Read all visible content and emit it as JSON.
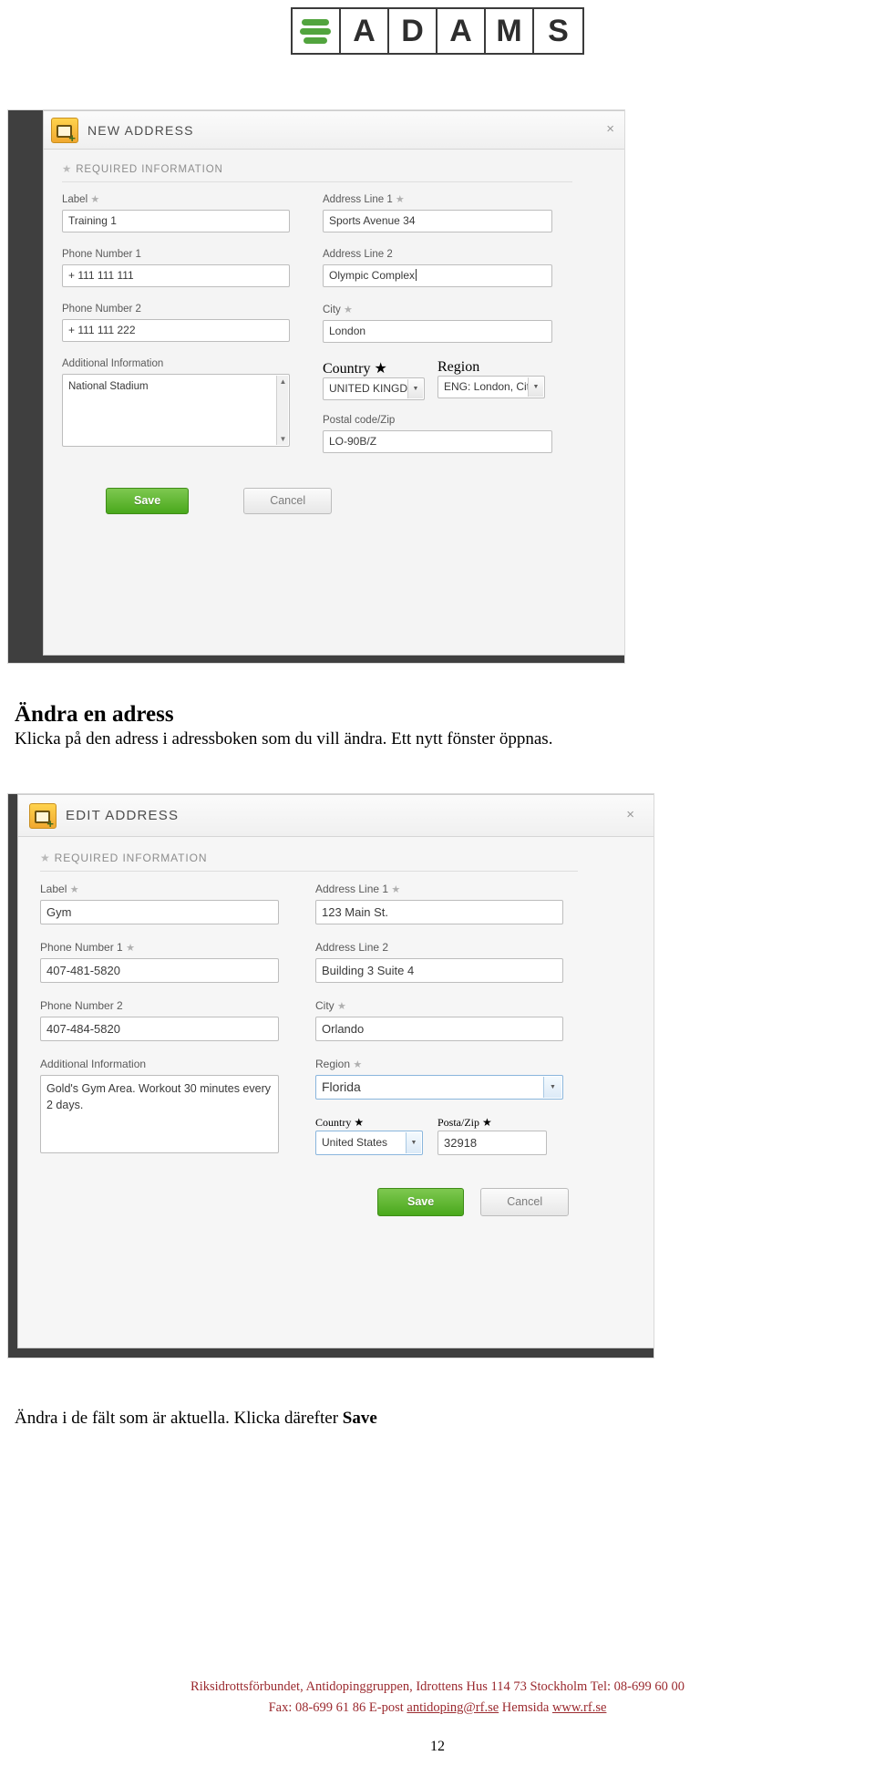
{
  "logo": {
    "letters": [
      "A",
      "D",
      "A",
      "M",
      "S"
    ],
    "leaf_icon": "adams-leaf-icon"
  },
  "screenshot_new": {
    "dialog": {
      "title": "NEW ADDRESS",
      "close_label": "×",
      "section_header": "REQUIRED INFORMATION",
      "required_star": "★",
      "fields": {
        "label": {
          "label": "Label",
          "value": "Training 1",
          "required": true
        },
        "phone1": {
          "label": "Phone Number 1",
          "value": "+ 111 111 111",
          "required": false
        },
        "phone2": {
          "label": "Phone Number 2",
          "value": "+ 111 111 222",
          "required": false
        },
        "additional": {
          "label": "Additional Information",
          "value": "National Stadium",
          "required": false
        },
        "address1": {
          "label": "Address Line 1",
          "value": "Sports Avenue 34",
          "required": true
        },
        "address2": {
          "label": "Address Line 2",
          "value": "Olympic Complex",
          "required": false
        },
        "city": {
          "label": "City",
          "value": "London",
          "required": true
        },
        "country": {
          "label": "Country",
          "value": "UNITED KINGD",
          "required": true
        },
        "region": {
          "label": "Region",
          "value": "ENG: London, Cit",
          "required": false
        },
        "postal": {
          "label": "Postal code/Zip",
          "value": "LO-90B/Z",
          "required": false
        }
      },
      "buttons": {
        "save": "Save",
        "cancel": "Cancel"
      }
    }
  },
  "text_heading": "Ändra en adress",
  "text_line1": "Klicka på den adress i adressboken som du vill ändra. Ett nytt fönster öppnas.",
  "screenshot_edit": {
    "dialog": {
      "title": "EDIT ADDRESS",
      "close_label": "×",
      "section_header": "REQUIRED INFORMATION",
      "required_star": "★",
      "fields": {
        "label": {
          "label": "Label",
          "value": "Gym",
          "required": true
        },
        "phone1": {
          "label": "Phone Number 1",
          "value": "407-481-5820",
          "required": true
        },
        "phone2": {
          "label": "Phone Number 2",
          "value": "407-484-5820",
          "required": false
        },
        "additional": {
          "label": "Additional Information",
          "value": "Gold's Gym Area. Workout 30 minutes every 2 days.",
          "required": false
        },
        "address1": {
          "label": "Address Line 1",
          "value": "123 Main St.",
          "required": true
        },
        "address2": {
          "label": "Address Line 2",
          "value": "Building 3 Suite 4",
          "required": false
        },
        "city": {
          "label": "City",
          "value": "Orlando",
          "required": true
        },
        "region": {
          "label": "Region",
          "value": "Florida",
          "required": true
        },
        "country": {
          "label": "Country",
          "value": "United States",
          "required": true
        },
        "postal": {
          "label": "Posta/Zip",
          "value": "32918",
          "required": true
        }
      },
      "buttons": {
        "save": "Save",
        "cancel": "Cancel"
      }
    }
  },
  "text_line2_pre": "Ändra i de fält som är aktuella.  Klicka därefter ",
  "text_line2_bold": "Save",
  "footer": {
    "line1": "Riksidrottsförbundet, Antidopinggruppen, Idrottens Hus 114 73 Stockholm Tel: 08-699 60 00",
    "line2_pre": "Fax: 08-699 61 86 E-post ",
    "line2_email": "antidoping@rf.se",
    "line2_mid": " Hemsida ",
    "line2_site": "www.rf.se",
    "page_number": "12"
  }
}
